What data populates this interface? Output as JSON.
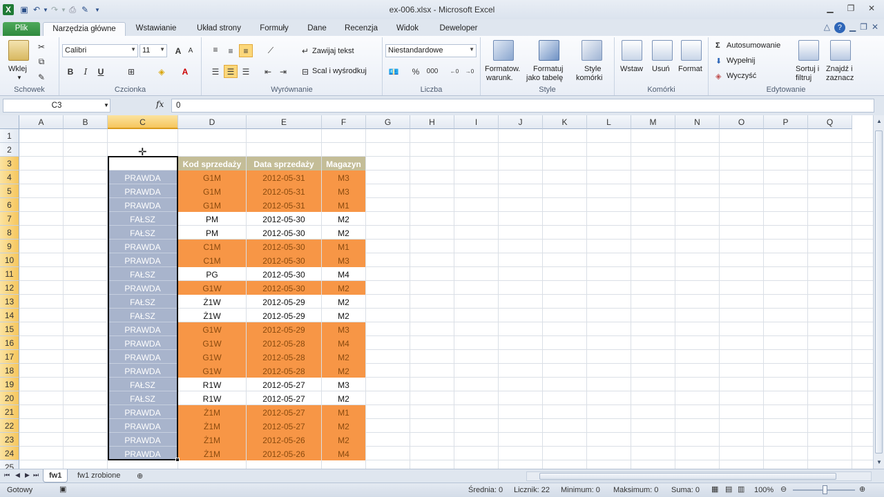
{
  "window": {
    "title": "ex-006.xlsx - Microsoft Excel",
    "app_icon": "X"
  },
  "tabs": [
    "Plik",
    "Narzędzia główne",
    "Wstawianie",
    "Układ strony",
    "Formuły",
    "Dane",
    "Recenzja",
    "Widok",
    "Deweloper"
  ],
  "ribbon": {
    "clipboard": {
      "paste_label": "Wklej",
      "group_label": "Schowek"
    },
    "font": {
      "name": "Calibri",
      "size": "11",
      "bold": "B",
      "italic": "I",
      "underline": "U",
      "grow": "A",
      "shrink": "A",
      "font_color": "A",
      "group_label": "Czcionka"
    },
    "alignment": {
      "wrap": "Zawijaj tekst",
      "merge": "Scal i wyśrodkuj",
      "group_label": "Wyrównanie"
    },
    "number": {
      "format": "Niestandardowe",
      "percent": "%",
      "thousands": "000",
      "inc_dec": ",0 ,00",
      "dec_dec": ",00 ,0",
      "group_label": "Liczba"
    },
    "styles": {
      "cond_format_1": "Formatow.",
      "cond_format_2": "warunk.",
      "table_1": "Formatuj",
      "table_2": "jako tabelę",
      "cell_styles_1": "Style",
      "cell_styles_2": "komórki",
      "group_label": "Style"
    },
    "cells": {
      "insert": "Wstaw",
      "delete": "Usuń",
      "format": "Format",
      "group_label": "Komórki"
    },
    "editing": {
      "autosum": "Autosumowanie",
      "fill": "Wypełnij",
      "clear": "Wyczyść",
      "sort_1": "Sortuj i",
      "sort_2": "filtruj",
      "find_1": "Znajdź i",
      "find_2": "zaznacz",
      "group_label": "Edytowanie"
    }
  },
  "formula_bar": {
    "name_box": "C3",
    "fx": "fx",
    "value": "0"
  },
  "columns": [
    "A",
    "B",
    "C",
    "D",
    "E",
    "F",
    "G",
    "H",
    "I",
    "J",
    "K",
    "L",
    "M",
    "N",
    "O",
    "P",
    "Q"
  ],
  "rows": [
    "1",
    "2",
    "3",
    "4",
    "5",
    "6",
    "7",
    "8",
    "9",
    "10",
    "11",
    "12",
    "13",
    "14",
    "15",
    "16",
    "17",
    "18",
    "19",
    "20",
    "21",
    "22",
    "23",
    "24",
    "25"
  ],
  "table": {
    "headers": [
      "Kod sprzedaży",
      "Data sprzedaży",
      "Magazyn"
    ],
    "rows": [
      [
        "PRAWDA",
        "G1M",
        "2012-05-31",
        "M3",
        true
      ],
      [
        "PRAWDA",
        "G1M",
        "2012-05-31",
        "M3",
        true
      ],
      [
        "PRAWDA",
        "G1M",
        "2012-05-31",
        "M1",
        true
      ],
      [
        "FAŁSZ",
        "PM",
        "2012-05-30",
        "M2",
        false
      ],
      [
        "FAŁSZ",
        "PM",
        "2012-05-30",
        "M2",
        false
      ],
      [
        "PRAWDA",
        "C1M",
        "2012-05-30",
        "M1",
        true
      ],
      [
        "PRAWDA",
        "C1M",
        "2012-05-30",
        "M3",
        true
      ],
      [
        "FAŁSZ",
        "PG",
        "2012-05-30",
        "M4",
        false
      ],
      [
        "PRAWDA",
        "G1W",
        "2012-05-30",
        "M2",
        true
      ],
      [
        "FAŁSZ",
        "Ż1W",
        "2012-05-29",
        "M2",
        false
      ],
      [
        "FAŁSZ",
        "Ż1W",
        "2012-05-29",
        "M2",
        false
      ],
      [
        "PRAWDA",
        "G1W",
        "2012-05-29",
        "M3",
        true
      ],
      [
        "PRAWDA",
        "G1W",
        "2012-05-28",
        "M4",
        true
      ],
      [
        "PRAWDA",
        "G1W",
        "2012-05-28",
        "M2",
        true
      ],
      [
        "PRAWDA",
        "G1W",
        "2012-05-28",
        "M2",
        true
      ],
      [
        "FAŁSZ",
        "R1W",
        "2012-05-27",
        "M3",
        false
      ],
      [
        "FAŁSZ",
        "R1W",
        "2012-05-27",
        "M2",
        false
      ],
      [
        "PRAWDA",
        "Ż1M",
        "2012-05-27",
        "M1",
        true
      ],
      [
        "PRAWDA",
        "Ż1M",
        "2012-05-27",
        "M2",
        true
      ],
      [
        "PRAWDA",
        "Ż1M",
        "2012-05-26",
        "M2",
        true
      ],
      [
        "PRAWDA",
        "Ż1M",
        "2012-05-26",
        "M4",
        true
      ]
    ]
  },
  "sheets": [
    "fw1",
    "fw1 zrobione"
  ],
  "status": {
    "mode": "Gotowy",
    "average": "Średnia: 0",
    "count": "Licznik: 22",
    "min": "Minimum: 0",
    "max": "Maksimum: 0",
    "sum": "Suma: 0",
    "zoom": "100%"
  },
  "colors": {
    "bool_fill": "#a8b4cc",
    "highlight": "#f79646",
    "header_fill": "#c4bd97"
  }
}
